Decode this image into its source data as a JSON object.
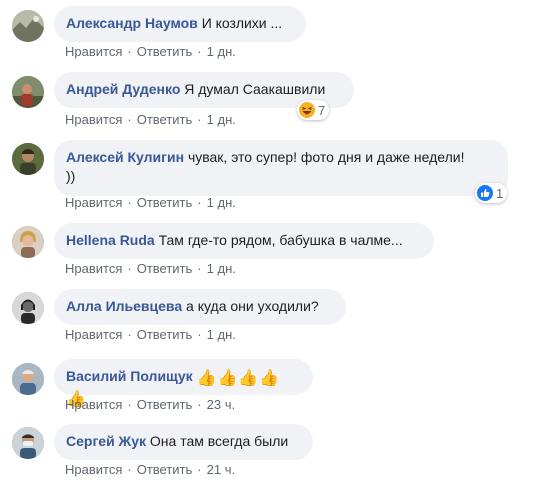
{
  "labels": {
    "like": "Нравится",
    "reply": "Ответить",
    "separator": "·"
  },
  "comments": [
    {
      "author": "Александр Наумов",
      "text": "И козлихи ...",
      "time": "1 дн.",
      "avatar": "avatar-photo"
    },
    {
      "author": "Андрей Дуденко",
      "text": "Я думал Саакашвили",
      "time": "1 дн.",
      "avatar": "avatar-photo",
      "reaction": {
        "icon": "haha-icon",
        "count": "7"
      }
    },
    {
      "author": "Алексей Кулигин",
      "text": "чувак, это супер! фото дня и даже недели!",
      "text2": "))",
      "time": "1 дн.",
      "avatar": "avatar-photo",
      "reaction": {
        "icon": "like-icon",
        "count": "1"
      }
    },
    {
      "author": "Hellena Ruda",
      "text": "Там где-то рядом, бабушка в чалме...",
      "time": "1 дн.",
      "avatar": "avatar-photo"
    },
    {
      "author": "Алла Ильевцева",
      "text": "а куда они уходили?",
      "time": "1 дн.",
      "avatar": "avatar-photo"
    },
    {
      "author": "Василий Полищук",
      "text": "👍👍👍👍👍",
      "time": "23 ч.",
      "avatar": "avatar-photo"
    },
    {
      "author": "Сергей Жук",
      "text": "Она там всегда были",
      "time": "21 ч.",
      "avatar": "avatar-photo"
    }
  ],
  "colors": {
    "author": "#385898",
    "bubble": "#f0f2f5",
    "meta": "#606770",
    "like_blue": "#1877f2",
    "haha_yellow": "#f7b125"
  }
}
